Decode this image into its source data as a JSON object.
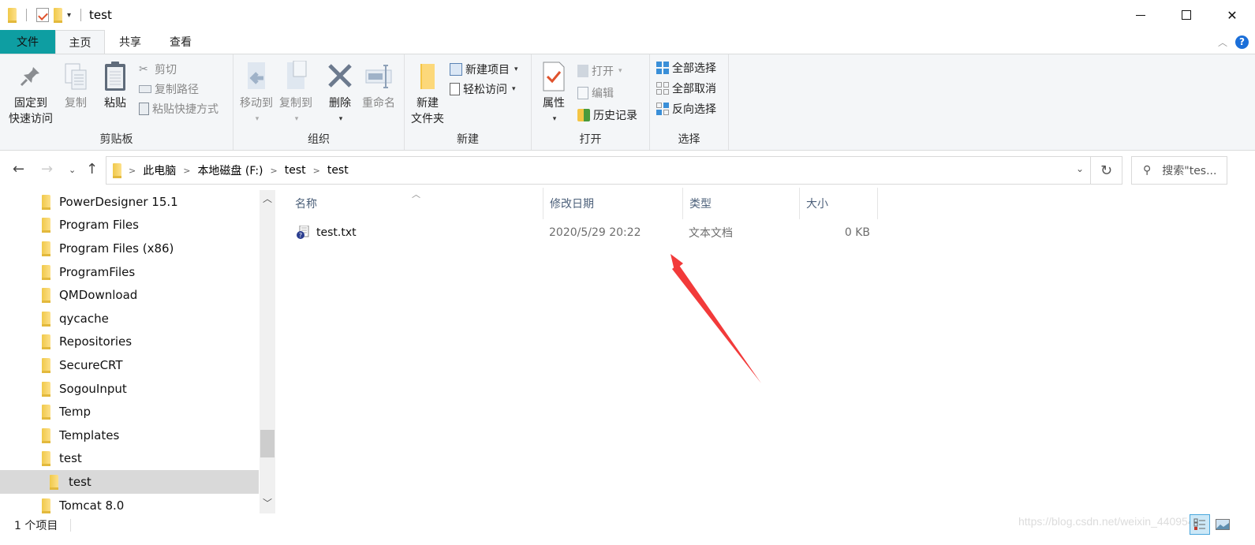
{
  "window": {
    "title": "test",
    "controls": {
      "minimize": "minimize",
      "maximize": "maximize",
      "close": "close"
    }
  },
  "quick_access": {
    "icons": [
      "folder-icon",
      "properties-check-icon",
      "new-folder-icon",
      "customize-dropdown-icon"
    ]
  },
  "tabs": [
    {
      "label": "文件",
      "type": "file"
    },
    {
      "label": "主页",
      "active": true
    },
    {
      "label": "共享"
    },
    {
      "label": "查看"
    }
  ],
  "ribbon": {
    "clipboard": {
      "label": "剪贴板",
      "pin": {
        "line1": "固定到",
        "line2": "快速访问"
      },
      "copy": "复制",
      "paste": "粘贴",
      "cut": "剪切",
      "copy_path": "复制路径",
      "paste_shortcut": "粘贴快捷方式"
    },
    "organize": {
      "label": "组织",
      "move_to": "移动到",
      "copy_to": "复制到",
      "delete": "删除",
      "rename": "重命名"
    },
    "new": {
      "label": "新建",
      "new_folder": {
        "line1": "新建",
        "line2": "文件夹"
      },
      "new_item": "新建项目",
      "easy_access": "轻松访问"
    },
    "open": {
      "label": "打开",
      "properties": "属性",
      "open": "打开",
      "edit": "编辑",
      "history": "历史记录"
    },
    "select": {
      "label": "选择",
      "select_all": "全部选择",
      "select_none": "全部取消",
      "invert": "反向选择"
    }
  },
  "address": {
    "breadcrumbs": [
      "此电脑",
      "本地磁盘 (F:)",
      "test",
      "test"
    ],
    "search_placeholder": "搜索\"tes..."
  },
  "nav_tree": [
    {
      "label": "PowerDesigner 15.1"
    },
    {
      "label": "Program Files"
    },
    {
      "label": "Program Files (x86)"
    },
    {
      "label": "ProgramFiles"
    },
    {
      "label": "QMDownload"
    },
    {
      "label": "qycache"
    },
    {
      "label": "Repositories"
    },
    {
      "label": "SecureCRT"
    },
    {
      "label": "SogouInput"
    },
    {
      "label": "Temp"
    },
    {
      "label": "Templates"
    },
    {
      "label": "test"
    },
    {
      "label": "test",
      "child": true,
      "selected": true
    },
    {
      "label": "Tomcat  8.0"
    }
  ],
  "file_list": {
    "columns": [
      "名称",
      "修改日期",
      "类型",
      "大小"
    ],
    "rows": [
      {
        "name": "test.txt",
        "modified": "2020/5/29 20:22",
        "type": "文本文档",
        "size": "0 KB"
      }
    ]
  },
  "status": {
    "item_count": "1 个项目"
  },
  "watermark": "https://blog.csdn.net/weixin_44095457",
  "colors": {
    "file_tab": "#0e9ea2",
    "ribbon_bg": "#f4f6f8",
    "annotation_arrow": "#f23a3a",
    "selected_row": "#d9d9d9"
  }
}
